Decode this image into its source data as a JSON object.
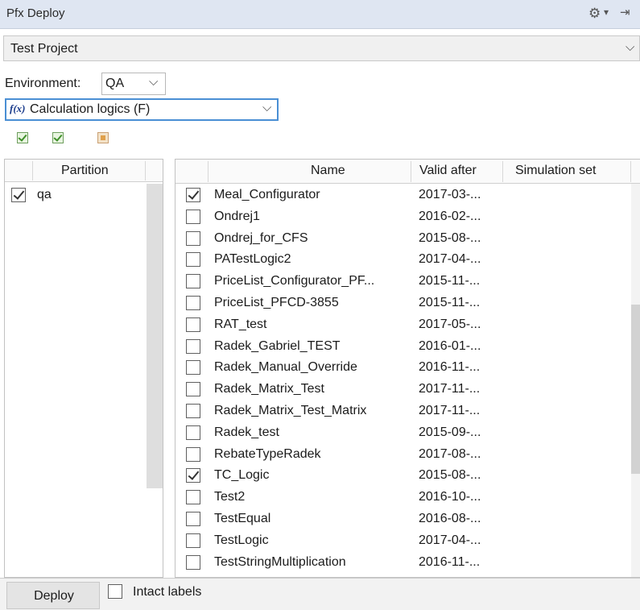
{
  "window": {
    "title": "Pfx Deploy"
  },
  "project": {
    "selected": "Test Project"
  },
  "environment": {
    "label": "Environment:",
    "selected": "QA"
  },
  "logics": {
    "icon_label": "f(x)",
    "selected": "Calculation logics (F)"
  },
  "toolbar": {
    "icons": [
      "select-all-icon",
      "select-visible-icon",
      "deselect-all-icon"
    ]
  },
  "partitions": {
    "header": "Partition",
    "rows": [
      {
        "name": "qa",
        "checked": true
      }
    ]
  },
  "logic_table": {
    "columns": [
      "Name",
      "Valid after",
      "Simulation set"
    ],
    "rows": [
      {
        "name": "Meal_Configurator",
        "valid_after": "2017-03-...",
        "checked": true
      },
      {
        "name": "Ondrej1",
        "valid_after": "2016-02-...",
        "checked": false
      },
      {
        "name": "Ondrej_for_CFS",
        "valid_after": "2015-08-...",
        "checked": false
      },
      {
        "name": "PATestLogic2",
        "valid_after": "2017-04-...",
        "checked": false
      },
      {
        "name": "PriceList_Configurator_PF...",
        "valid_after": "2015-11-...",
        "checked": false
      },
      {
        "name": "PriceList_PFCD-3855",
        "valid_after": "2015-11-...",
        "checked": false
      },
      {
        "name": "RAT_test",
        "valid_after": "2017-05-...",
        "checked": false
      },
      {
        "name": "Radek_Gabriel_TEST",
        "valid_after": "2016-01-...",
        "checked": false
      },
      {
        "name": "Radek_Manual_Override",
        "valid_after": "2016-11-...",
        "checked": false
      },
      {
        "name": "Radek_Matrix_Test",
        "valid_after": "2017-11-...",
        "checked": false
      },
      {
        "name": "Radek_Matrix_Test_Matrix",
        "valid_after": "2017-11-...",
        "checked": false
      },
      {
        "name": "Radek_test",
        "valid_after": "2015-09-...",
        "checked": false
      },
      {
        "name": "RebateTypeRadek",
        "valid_after": "2017-08-...",
        "checked": false
      },
      {
        "name": "TC_Logic",
        "valid_after": "2015-08-...",
        "checked": true
      },
      {
        "name": "Test2",
        "valid_after": "2016-10-...",
        "checked": false
      },
      {
        "name": "TestEqual",
        "valid_after": "2016-08-...",
        "checked": false
      },
      {
        "name": "TestLogic",
        "valid_after": "2017-04-...",
        "checked": false
      },
      {
        "name": "TestStringMultiplication",
        "valid_after": "2016-11-...",
        "checked": false
      }
    ]
  },
  "footer": {
    "deploy_label": "Deploy",
    "intact_label": "Intact labels",
    "intact_checked": false
  }
}
